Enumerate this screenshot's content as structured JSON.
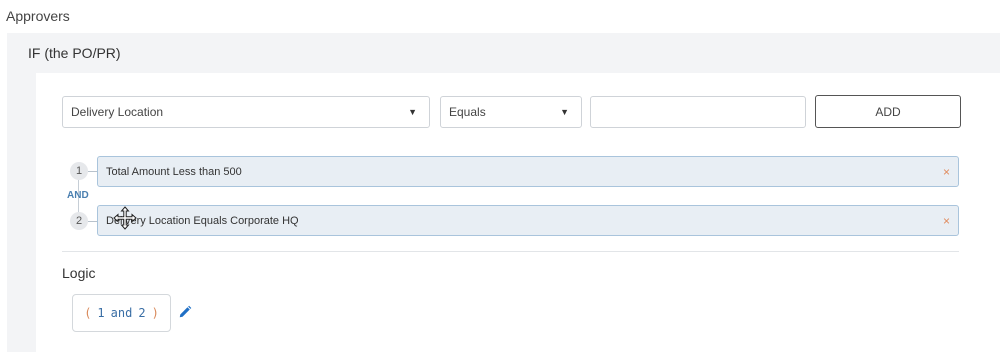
{
  "section": {
    "title": "Approvers"
  },
  "condition_panel": {
    "title": "IF (the PO/PR)"
  },
  "builder": {
    "field_select": "Delivery Location",
    "operator_select": "Equals",
    "value_input": "",
    "add_label": "ADD"
  },
  "conditions": [
    {
      "num": "1",
      "text": "Total Amount Less than 500"
    },
    {
      "num": "2",
      "text": "Delivery Location Equals Corporate HQ"
    }
  ],
  "joiner": "AND",
  "logic": {
    "title": "Logic",
    "open": "(",
    "a": "1",
    "op": "and",
    "b": "2",
    "close": ")"
  },
  "colors": {
    "accent": "#1f6fc5",
    "remove": "#e08a5c",
    "condition_bg": "#e8eef4"
  }
}
